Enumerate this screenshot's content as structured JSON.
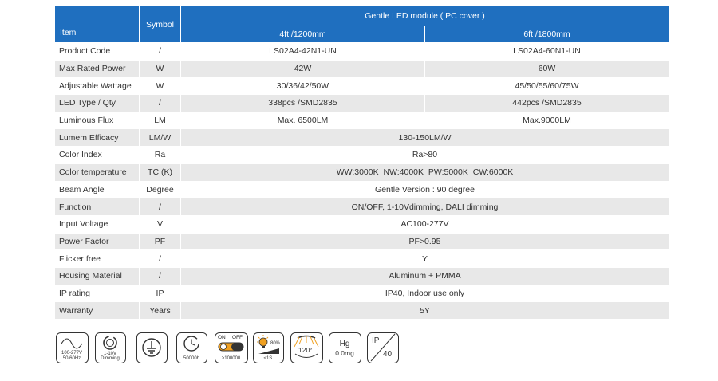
{
  "header": {
    "item": "Item",
    "symbol": "Symbol",
    "group": "Gentle LED module ( PC cover )",
    "variant_a": "4ft /1200mm",
    "variant_b": "6ft /1800mm"
  },
  "rows": [
    {
      "item": "Product Code",
      "symbol": "/",
      "a": "LS02A4-42N1-UN",
      "b": "LS02A4-60N1-UN"
    },
    {
      "item": "Max Rated Power",
      "symbol": "W",
      "a": "42W",
      "b": "60W"
    },
    {
      "item": "Adjustable Wattage",
      "symbol": "W",
      "a": "30/36/42/50W",
      "b": "45/50/55/60/75W"
    },
    {
      "item": "LED Type / Qty",
      "symbol": "/",
      "a": "338pcs /SMD2835",
      "b": "442pcs /SMD2835"
    },
    {
      "item": "Luminous Flux",
      "symbol": "LM",
      "a": "Max. 6500LM",
      "b": "Max.9000LM"
    },
    {
      "item": "Lumem Efficacy",
      "symbol": "LM/W",
      "value": "130-150LM/W"
    },
    {
      "item": "Color Index",
      "symbol": "Ra",
      "value": "Ra>80"
    },
    {
      "item": "Color temperature",
      "symbol": "TC (K)",
      "value": "WW:3000K  NW:4000K  PW:5000K  CW:6000K"
    },
    {
      "item": "Beam Angle",
      "symbol": "Degree",
      "value": "Gentle Version : 90 degree"
    },
    {
      "item": "Function",
      "symbol": "/",
      "value": "ON/OFF, 1-10Vdimming, DALI dimming"
    },
    {
      "item": "Input Voltage",
      "symbol": "V",
      "value": "AC100-277V"
    },
    {
      "item": "Power Factor",
      "symbol": "PF",
      "value": "PF>0.95"
    },
    {
      "item": "Flicker free",
      "symbol": "/",
      "value": "Y"
    },
    {
      "item": "Housing Material",
      "symbol": "/",
      "value": "Aluminum + PMMA"
    },
    {
      "item": "IP rating",
      "symbol": "IP",
      "value": "IP40, Indoor use only"
    },
    {
      "item": "Warranty",
      "symbol": "Years",
      "value": "5Y"
    }
  ],
  "icons": {
    "voltage": {
      "line1": "100-277V",
      "line2": "50/60Hz"
    },
    "dimming": {
      "line1": "1-10V",
      "line2": "Dimming"
    },
    "lifetime": {
      "label": "50000h"
    },
    "switch": {
      "on": "ON",
      "off": "OFF",
      "label": ">100000"
    },
    "instant": {
      "percent": "80%",
      "label": "≤1S"
    },
    "beam": {
      "label": "120°"
    },
    "mercury": {
      "line1": "Hg",
      "line2": "0.0mg"
    },
    "ip": {
      "line1": "IP",
      "line2": "40"
    }
  },
  "colors": {
    "header": "#1f6fbf",
    "stripe": "#e8e8e8",
    "switch_on": "#f0a020",
    "lamp": "#f0a020"
  }
}
